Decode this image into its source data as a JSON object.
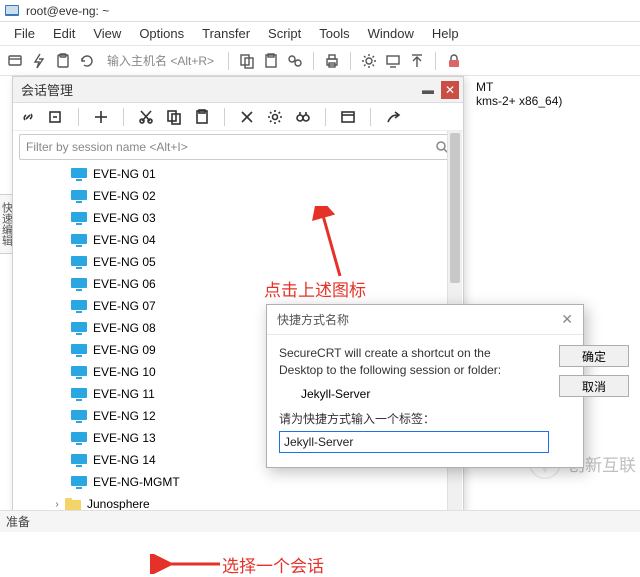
{
  "window": {
    "title": "root@eve-ng: ~"
  },
  "menu": [
    "File",
    "Edit",
    "View",
    "Options",
    "Transfer",
    "Script",
    "Tools",
    "Window",
    "Help"
  ],
  "toolbar": {
    "host_placeholder": "输入主机名 <Alt+R>"
  },
  "terminal": {
    "line1": "MT",
    "line2": "kms-2+ x86_64)"
  },
  "panel": {
    "title": "会话管理",
    "filter_placeholder": "Filter by session name <Alt+I>",
    "nodes": [
      "EVE-NG 01",
      "EVE-NG 02",
      "EVE-NG 03",
      "EVE-NG 04",
      "EVE-NG 05",
      "EVE-NG 06",
      "EVE-NG 07",
      "EVE-NG 08",
      "EVE-NG 09",
      "EVE-NG 10",
      "EVE-NG 11",
      "EVE-NG 12",
      "EVE-NG 13",
      "EVE-NG 14",
      "EVE-NG-MGMT"
    ],
    "folder": "Junosphere",
    "selected": "Jekyll-Server"
  },
  "dialog": {
    "title": "快捷方式名称",
    "line1": "SecureCRT will create a shortcut on the",
    "line2": "Desktop to the following session or folder:",
    "session": "Jekyll-Server",
    "prompt": "请为快捷方式输入一个标签：",
    "value": "Jekyll-Server",
    "ok": "确定",
    "cancel": "取消"
  },
  "annotations": {
    "click": "点击上述图标",
    "select": "选择一个会话"
  },
  "sidetab": "快速编辑",
  "footer": "准备",
  "watermark": "创新互联"
}
